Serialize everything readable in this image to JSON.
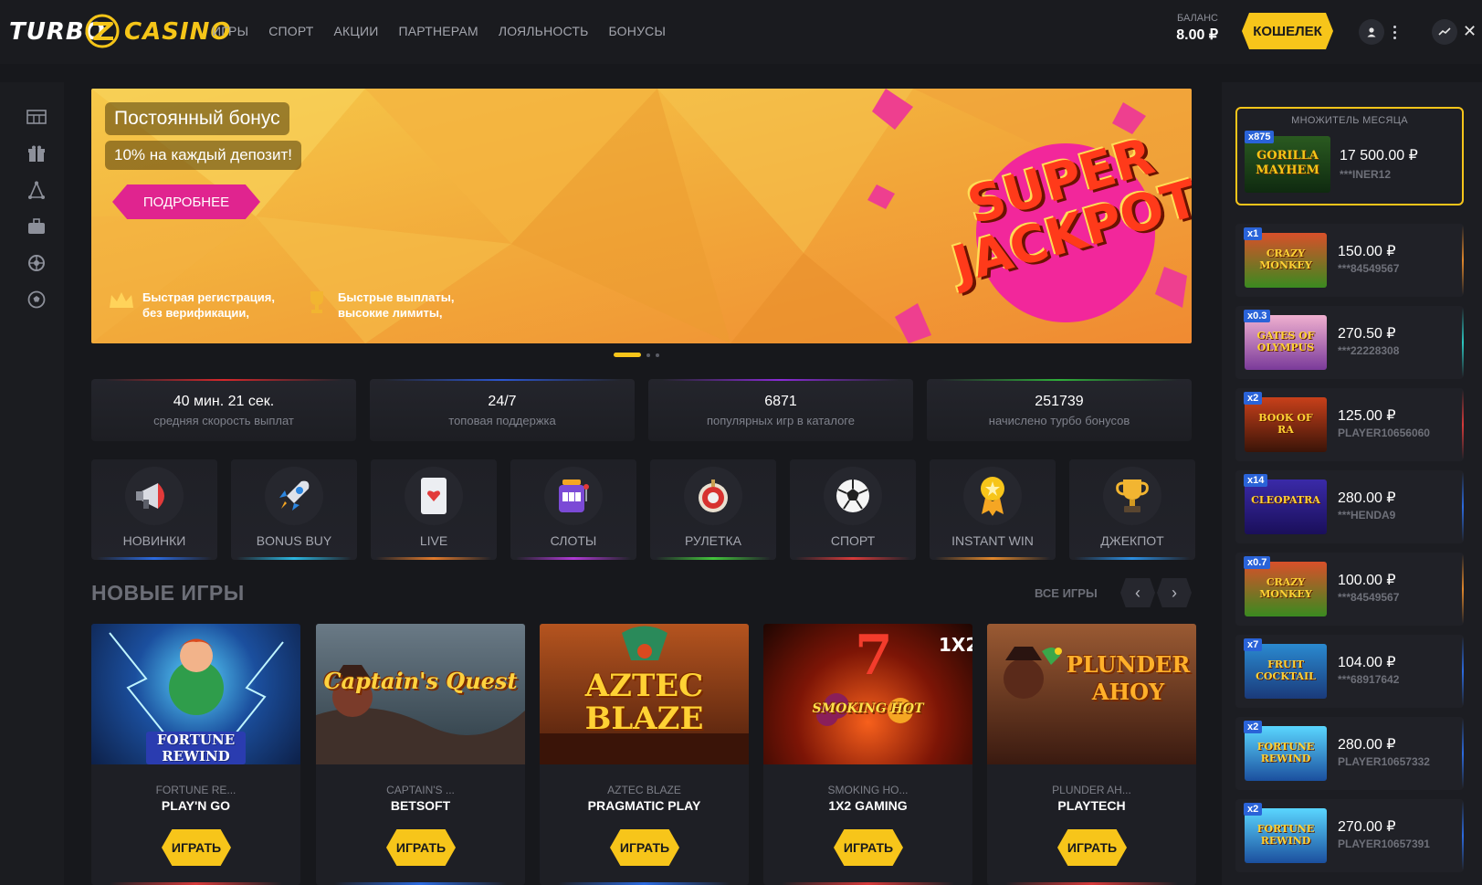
{
  "header": {
    "logo_left": "TURBO",
    "logo_right": "CASINO",
    "nav": [
      "ИГРЫ",
      "СПОРТ",
      "АКЦИИ",
      "ПАРТНЕРАМ",
      "ЛОЯЛЬНОСТЬ",
      "БОНУСЫ"
    ],
    "balance_label": "БАЛАНС",
    "balance_value": "8.00 ₽",
    "wallet_label": "КОШЕЛЕК",
    "close_glyph": "✕"
  },
  "sidebar": {
    "icons": [
      "tournaments-icon",
      "gift-icon",
      "lottery-icon",
      "briefcase-icon",
      "wheel-icon",
      "football-icon"
    ]
  },
  "banner": {
    "title": "Постоянный бонус",
    "subtitle": "10% на каждый депозит!",
    "button": "ПОДРОБНЕЕ",
    "art_line1": "SUPER",
    "art_line2": "JACKPOT",
    "features": [
      {
        "icon": "crown-icon",
        "line1": "Быстрая регистрация,",
        "line2": "без верификации,"
      },
      {
        "icon": "trophy-icon",
        "line1": "Быстрые выплаты,",
        "line2": "высокие лимиты,"
      }
    ]
  },
  "stats": [
    {
      "value": "40 мин. 21 сек.",
      "label": "средняя скорость выплат",
      "color": "#d6272b"
    },
    {
      "value": "24/7",
      "label": "топовая поддержка",
      "color": "#2c56d1"
    },
    {
      "value": "6871",
      "label": "популярных игр в каталоге",
      "color": "#8a2bd6"
    },
    {
      "value": "251739",
      "label": "начислено турбо бонусов",
      "color": "#2fae3a"
    }
  ],
  "categories": [
    {
      "label": "НОВИНКИ",
      "icon": "megaphone-icon",
      "color": "#2c6be0"
    },
    {
      "label": "BONUS BUY",
      "icon": "rocket-icon",
      "color": "#2cb6e0"
    },
    {
      "label": "LIVE",
      "icon": "card-icon",
      "color": "#e07a2c"
    },
    {
      "label": "СЛОТЫ",
      "icon": "slot-machine-icon",
      "color": "#b03ad6"
    },
    {
      "label": "РУЛЕТКА",
      "icon": "roulette-icon",
      "color": "#43c43c"
    },
    {
      "label": "СПОРТ",
      "icon": "soccer-ball-icon",
      "color": "#d63a3a"
    },
    {
      "label": "INSTANT WIN",
      "icon": "medal-icon",
      "color": "#e0872c"
    },
    {
      "label": "ДЖЕКПОТ",
      "icon": "trophy-icon",
      "color": "#2c8ee0"
    }
  ],
  "new_games": {
    "title": "НОВЫЕ ИГРЫ",
    "all_label": "ВСЕ ИГРЫ",
    "play_label": "ИГРАТЬ",
    "games": [
      {
        "name": "FORTUNE RE...",
        "provider": "PLAY'N GO",
        "art": "FORTUNE REWIND",
        "color": "#d63a3a"
      },
      {
        "name": "CAPTAIN'S ...",
        "provider": "BETSOFT",
        "art": "Captain's Quest",
        "color": "#2c6be0"
      },
      {
        "name": "AZTEC BLAZE",
        "provider": "PRAGMATIC PLAY",
        "art": "AZTEC BLAZE",
        "color": "#2c6be0"
      },
      {
        "name": "SMOKING HO...",
        "provider": "1X2 GAMING",
        "art": "SMOKING HOT",
        "color": "#d63a3a"
      },
      {
        "name": "PLUNDER AH...",
        "provider": "PLAYTECH",
        "art": "PLUNDER AHOY",
        "color": "#d63a3a"
      }
    ]
  },
  "right_panel": {
    "month_title": "МНОЖИТЕЛЬ МЕСЯЦА",
    "month_winner": {
      "mult": "x875",
      "amount": "17 500.00 ₽",
      "user": "***INER12",
      "art": "GORILLA MAYHEM"
    },
    "wins": [
      {
        "mult": "x1",
        "amount": "150.00 ₽",
        "user": "***84549567",
        "art": "CRAZY MONKEY",
        "color": "#e0872c"
      },
      {
        "mult": "x0.3",
        "amount": "270.50 ₽",
        "user": "***22228308",
        "art": "GATES OF OLYMPUS",
        "color": "#2cc6c0"
      },
      {
        "mult": "x2",
        "amount": "125.00 ₽",
        "user": "PLAYER10656060",
        "art": "BOOK OF RA",
        "color": "#d63a3a"
      },
      {
        "mult": "x14",
        "amount": "280.00 ₽",
        "user": "***HENDA9",
        "art": "CLEOPATRA",
        "color": "#2c6be0"
      },
      {
        "mult": "x0.7",
        "amount": "100.00 ₽",
        "user": "***84549567",
        "art": "CRAZY MONKEY",
        "color": "#e0872c"
      },
      {
        "mult": "x7",
        "amount": "104.00 ₽",
        "user": "***68917642",
        "art": "FRUIT COCKTAIL",
        "color": "#2c6be0"
      },
      {
        "mult": "x2",
        "amount": "280.00 ₽",
        "user": "PLAYER10657332",
        "art": "FORTUNE REWIND",
        "color": "#2c6be0"
      },
      {
        "mult": "x2",
        "amount": "270.00 ₽",
        "user": "PLAYER10657391",
        "art": "FORTUNE REWIND",
        "color": "#2c6be0"
      }
    ]
  }
}
